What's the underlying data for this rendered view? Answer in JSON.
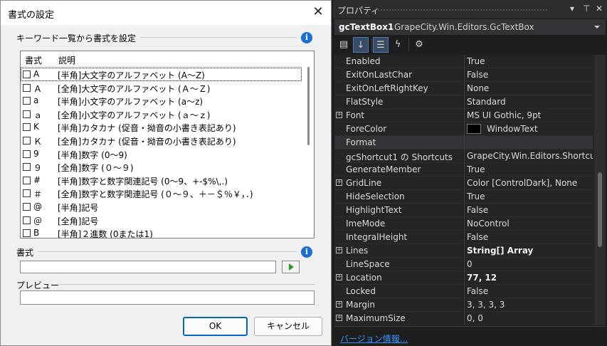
{
  "dialog": {
    "title": "書式の設定",
    "close_glyph": "✕",
    "keyword_group": {
      "label": "キーワード一覧から書式を設定",
      "columns": [
        "書式",
        "説明"
      ],
      "rows": [
        {
          "symbol": "A",
          "description": "[半角]大文字のアルファベット (A～Z)"
        },
        {
          "symbol": "Ａ",
          "description": "[全角]大文字のアルファベット (Ａ～Ｚ)"
        },
        {
          "symbol": "a",
          "description": "[半角]小文字のアルファベット (a～z)"
        },
        {
          "symbol": "ａ",
          "description": "[全角]小文字のアルファベット (ａ～ｚ)"
        },
        {
          "symbol": "K",
          "description": "[半角]カタカナ (促音・拗音の小書き表記あり)"
        },
        {
          "symbol": "Ｋ",
          "description": "[全角]カタカナ (促音・拗音の小書き表記あり)"
        },
        {
          "symbol": "9",
          "description": "[半角]数字 (0～9)"
        },
        {
          "symbol": "９",
          "description": "[全角]数字 (０～９)"
        },
        {
          "symbol": "#",
          "description": "[半角]数字と数字関連記号 (0～9、+-$%\\,.)"
        },
        {
          "symbol": "＃",
          "description": "[全角]数字と数字関連記号 (０～９、＋－＄％￥，．)"
        },
        {
          "symbol": "@",
          "description": "[半角]記号"
        },
        {
          "symbol": "＠",
          "description": "[全角]記号"
        },
        {
          "symbol": "B",
          "description": "[半角]２進数 (0または1)"
        }
      ]
    },
    "format_group": {
      "label": "書式",
      "value": ""
    },
    "preview_group": {
      "label": "プレビュー",
      "value": ""
    },
    "ok_label": "OK",
    "cancel_label": "キャンセル"
  },
  "properties": {
    "title": "プロパティ",
    "title_icons": [
      "▾",
      "⊤",
      "✕"
    ],
    "object_name": "gcTextBox1",
    "object_type": "GrapeCity.Win.Editors.GcTextBox",
    "rows": [
      {
        "name": "Enabled",
        "value": "True"
      },
      {
        "name": "ExitOnLastChar",
        "value": "False"
      },
      {
        "name": "ExitOnLeftRightKey",
        "value": "None"
      },
      {
        "name": "FlatStyle",
        "value": "Standard"
      },
      {
        "name": "Font",
        "value": "MS UI Gothic, 9pt",
        "expandable": true
      },
      {
        "name": "ForeColor",
        "value": "WindowText",
        "swatch": "#000000"
      },
      {
        "name": "Format",
        "value": "",
        "selected": true
      },
      {
        "name": "gcShortcut1 の Shortcuts",
        "value": "GrapeCity.Win.Editors.ShortcutCo"
      },
      {
        "name": "GenerateMember",
        "value": "True"
      },
      {
        "name": "GridLine",
        "value": "Color [ControlDark], None",
        "expandable": true
      },
      {
        "name": "HideSelection",
        "value": "True"
      },
      {
        "name": "HighlightText",
        "value": "False"
      },
      {
        "name": "ImeMode",
        "value": "NoControl"
      },
      {
        "name": "IntegralHeight",
        "value": "False"
      },
      {
        "name": "Lines",
        "value": "String[] Array",
        "expandable": true,
        "bold": true
      },
      {
        "name": "LineSpace",
        "value": "0"
      },
      {
        "name": "Location",
        "value": "77, 12",
        "expandable": true,
        "bold": true
      },
      {
        "name": "Locked",
        "value": "False"
      },
      {
        "name": "Margin",
        "value": "3, 3, 3, 3",
        "expandable": true
      },
      {
        "name": "MaximumSize",
        "value": "0, 0",
        "expandable": true
      }
    ],
    "version_link": "バージョン情報..."
  }
}
